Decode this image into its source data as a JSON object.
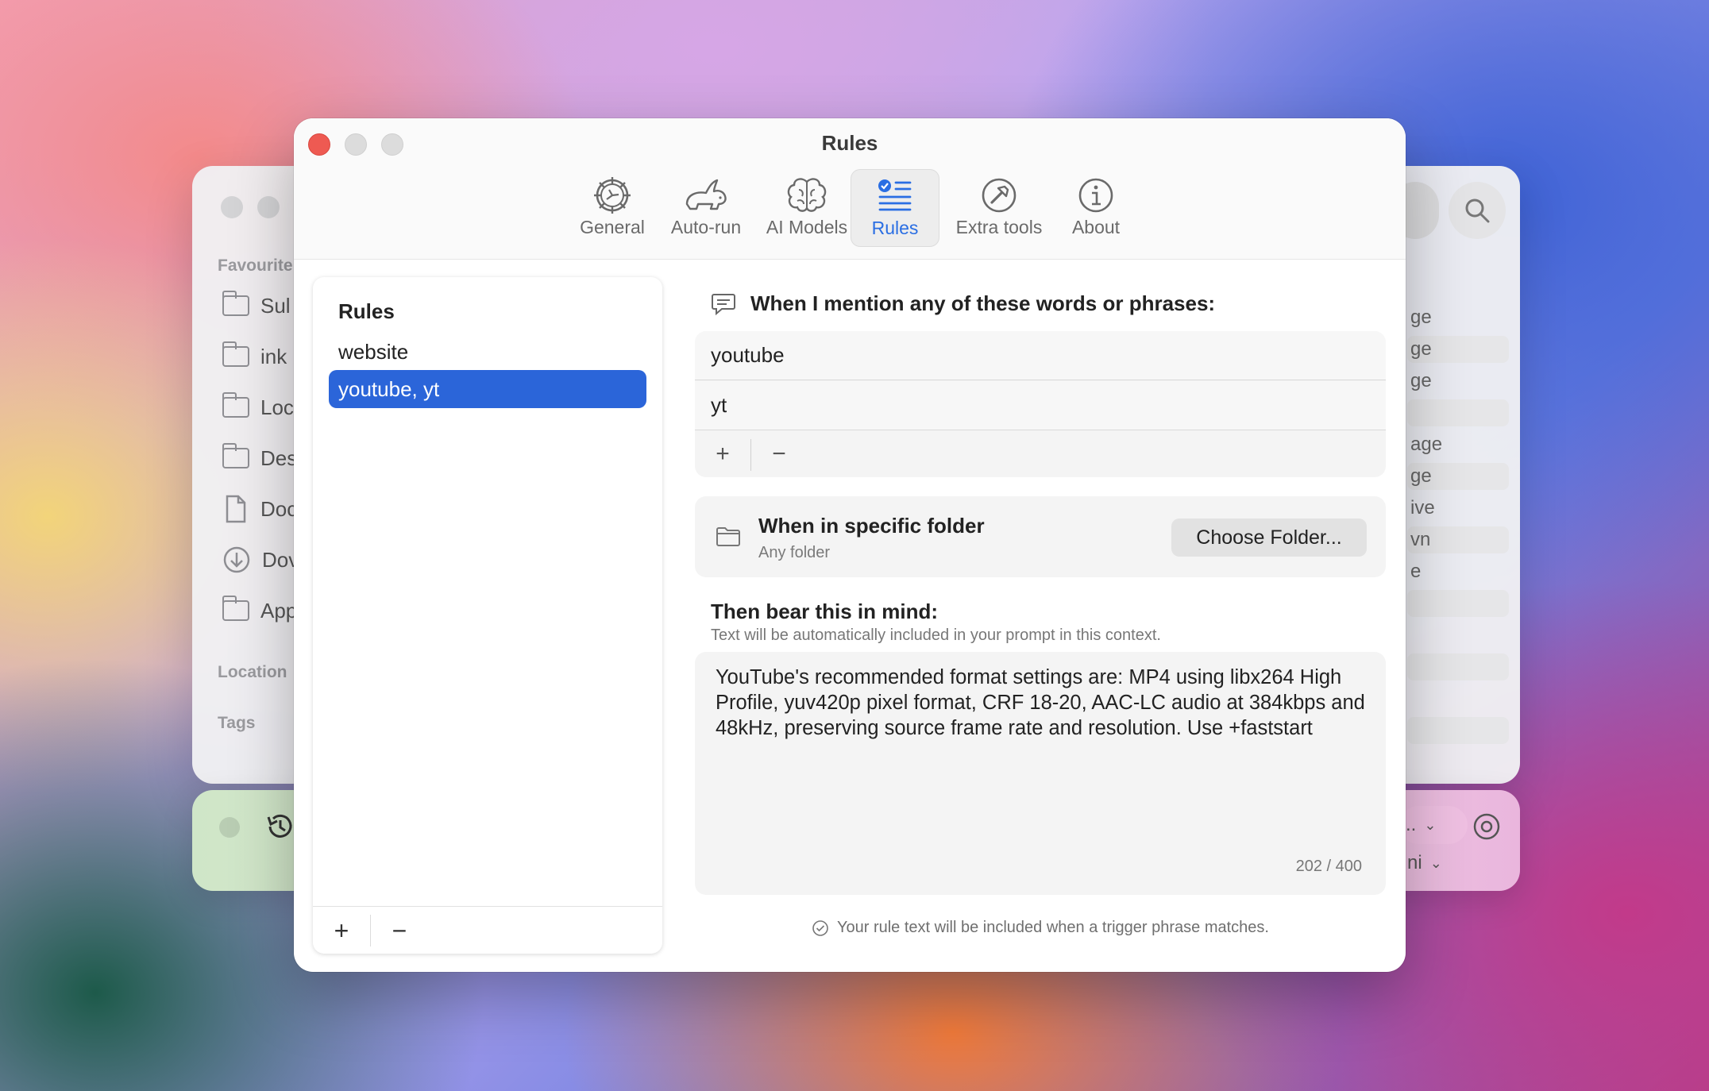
{
  "window": {
    "title": "Rules"
  },
  "toolbar": {
    "items": [
      {
        "label": "General",
        "icon": "gear-icon"
      },
      {
        "label": "Auto-run",
        "icon": "rabbit-icon"
      },
      {
        "label": "AI Models",
        "icon": "brain-icon"
      },
      {
        "label": "Rules",
        "icon": "checklist-icon",
        "active": true
      },
      {
        "label": "Extra tools",
        "icon": "hammer-icon"
      },
      {
        "label": "About",
        "icon": "info-icon"
      }
    ]
  },
  "rules_list": {
    "heading": "Rules",
    "items": [
      "website",
      "youtube, yt"
    ],
    "selected_index": 1,
    "add_label": "+",
    "remove_label": "−"
  },
  "trigger": {
    "title": "When I mention any of these words or phrases:",
    "phrases": [
      "youtube",
      "yt"
    ],
    "add_label": "+",
    "remove_label": "−"
  },
  "folder": {
    "title": "When in specific folder",
    "subtitle": "Any folder",
    "button_label": "Choose Folder..."
  },
  "bear": {
    "title": "Then bear this in mind:",
    "subtitle": "Text will be automatically included in your prompt in this context.",
    "text": "YouTube's recommended format settings are: MP4 using libx264 High Profile, yuv420p pixel format, CRF 18-20, AAC-LC audio at 384kbps and 48kHz, preserving source frame rate and resolution. Use +faststart",
    "counter": "202 / 400"
  },
  "footnote": "Your rule text will be included when a trigger phrase matches.",
  "background_finder": {
    "sidebar_heading": "Favourite",
    "sidebar_items": [
      "Sul",
      "ink",
      "Loc",
      "Des",
      "Doc",
      "Dov",
      "App"
    ],
    "locations_heading": "Location",
    "tags_heading": "Tags",
    "right_column": [
      "ge",
      "ge",
      "ge",
      "",
      "age",
      "ge",
      "ive",
      "vn",
      "e",
      "",
      "",
      ""
    ]
  },
  "background_bar": {
    "right_top": "..",
    "right_bottom": "ni"
  },
  "colors": {
    "accent": "#2b65d9",
    "close": "#ee5a52"
  }
}
